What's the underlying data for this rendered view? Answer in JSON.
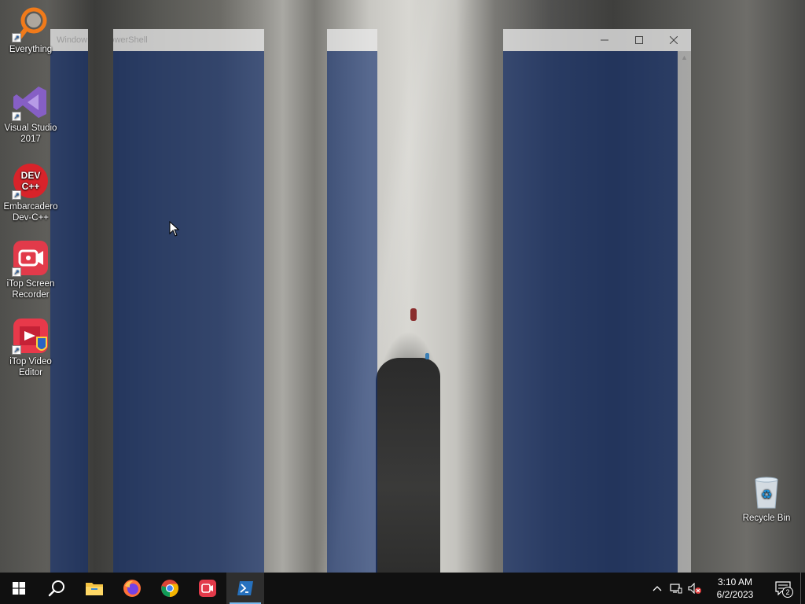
{
  "desktop": {
    "icons": [
      {
        "label": "Everything",
        "icon": "everything-search-icon"
      },
      {
        "label": "Visual Studio 2017",
        "icon": "visual-studio-icon"
      },
      {
        "label": "Embarcadero Dev-C++",
        "icon": "devcpp-icon",
        "badge": "DEV C++"
      },
      {
        "label": "iTop Screen Recorder",
        "icon": "itop-screen-recorder-icon"
      },
      {
        "label": "iTop Video Editor",
        "icon": "itop-video-editor-icon"
      },
      {
        "label": "Recycle Bin",
        "icon": "recycle-bin-icon"
      }
    ]
  },
  "windows": [
    {
      "title": "Window"
    },
    {
      "title": "PowerShell"
    },
    {
      "title": ""
    },
    {
      "title": ""
    }
  ],
  "taskbar": {
    "apps": [
      "start-icon",
      "search-icon",
      "file-explorer-icon",
      "firefox-icon",
      "chrome-icon",
      "itop-recorder-taskbar-icon",
      "powershell-icon"
    ],
    "clock": {
      "time": "3:10 AM",
      "date": "6/2/2023"
    },
    "notification_count": "2"
  },
  "colors": {
    "taskbar": "#101010",
    "window_tint": "#122e70",
    "accent": "#76b9ed"
  }
}
